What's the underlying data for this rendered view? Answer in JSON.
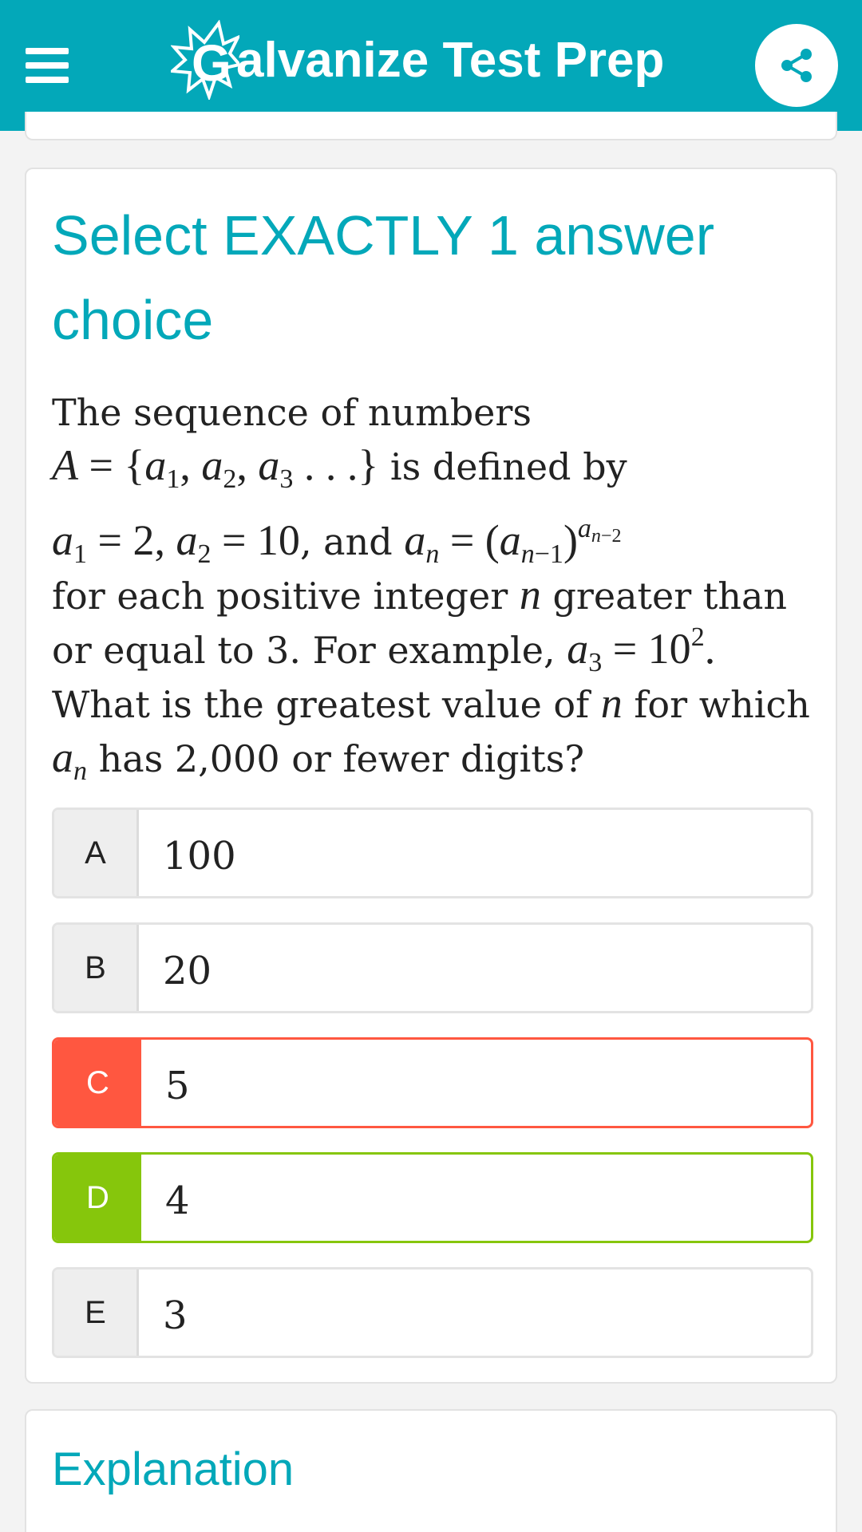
{
  "header": {
    "logo_letter": "G",
    "title": "alvanize Test Prep",
    "brand_color": "#03a8b9"
  },
  "question_card": {
    "instruction": "Select EXACTLY 1 answer choice",
    "question": {
      "l1": "The sequence of numbers",
      "l2_text": "is defined by",
      "l3_and": ", and",
      "l4": "for each positive integer",
      "l4b": "greater than",
      "l5": "or equal to 3. For example,",
      "l6": "What is the greatest value of",
      "l6b": "for which",
      "l7": "has 2,000 or fewer digits?"
    },
    "choices": [
      {
        "letter": "A",
        "value": "100",
        "state": "default"
      },
      {
        "letter": "B",
        "value": "20",
        "state": "default"
      },
      {
        "letter": "C",
        "value": "5",
        "state": "wrong"
      },
      {
        "letter": "D",
        "value": "4",
        "state": "correct"
      },
      {
        "letter": "E",
        "value": "3",
        "state": "default"
      }
    ]
  },
  "explanation": {
    "title": "Explanation"
  },
  "colors": {
    "accent": "#03a8b9",
    "wrong": "#ff5740",
    "correct": "#86c60c"
  }
}
